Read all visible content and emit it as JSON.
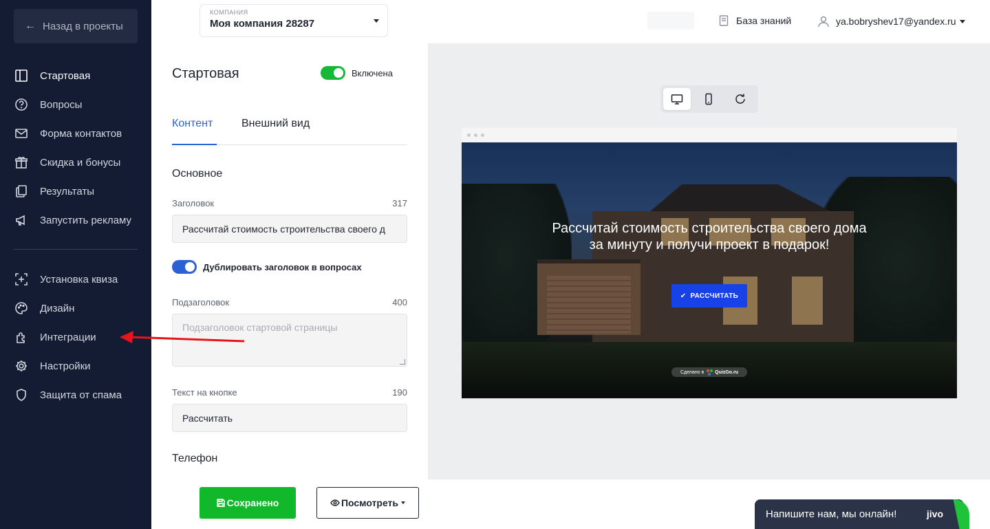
{
  "sidebar": {
    "back_label": "Назад в проекты",
    "items_top": [
      {
        "label": "Стартовая",
        "icon": "start-page-icon",
        "active": true
      },
      {
        "label": "Вопросы",
        "icon": "question-circle-icon"
      },
      {
        "label": "Форма контактов",
        "icon": "envelope-icon"
      },
      {
        "label": "Скидка и бонусы",
        "icon": "gift-icon"
      },
      {
        "label": "Результаты",
        "icon": "results-icon"
      },
      {
        "label": "Запустить рекламу",
        "icon": "megaphone-icon"
      }
    ],
    "items_bottom": [
      {
        "label": "Установка квиза",
        "icon": "install-icon"
      },
      {
        "label": "Дизайн",
        "icon": "palette-icon"
      },
      {
        "label": "Интеграции",
        "icon": "puzzle-icon"
      },
      {
        "label": "Настройки",
        "icon": "gear-icon"
      },
      {
        "label": "Защита от спама",
        "icon": "shield-icon"
      }
    ]
  },
  "topbar": {
    "company_caption": "КОМПАНИЯ",
    "company_name": "Моя компания 28287",
    "knowledge_base": "База знаний",
    "user_email": "ya.bobryshev17@yandex.ru"
  },
  "editor": {
    "title": "Стартовая",
    "enabled_label": "Включена",
    "tab_content": "Контент",
    "tab_appearance": "Внешний вид",
    "section_main": "Основное",
    "heading_label": "Заголовок",
    "heading_count": "317",
    "heading_value": "Рассчитай стоимость строительства своего д",
    "duplicate_label": "Дублировать заголовок в вопросах",
    "subheading_label": "Подзаголовок",
    "subheading_count": "400",
    "subheading_placeholder": "Подзаголовок стартовой страницы",
    "button_text_label": "Текст на кнопке",
    "button_text_count": "190",
    "button_text_value": "Рассчитать",
    "section_phone": "Телефон"
  },
  "preview": {
    "hero_title": "Рассчитай стоимость строительства своего дома за минуту и получи проект в подарок!",
    "hero_button": "РАССЧИТАТЬ",
    "made_by": "Сделано в",
    "made_by_brand": "QuizGo.ru"
  },
  "bottombar": {
    "save_label": "Сохранено",
    "view_label": "Посмотреть",
    "chat_label": "Напишите нам, мы онлайн!",
    "chat_brand": "jivo"
  },
  "colors": {
    "sidebar_bg": "#131c33",
    "accent_blue": "#2a62d6",
    "toggle_green": "#17b839",
    "save_green": "#11b82a",
    "hero_button": "#1742e8",
    "annotation_red": "#e8141b"
  }
}
